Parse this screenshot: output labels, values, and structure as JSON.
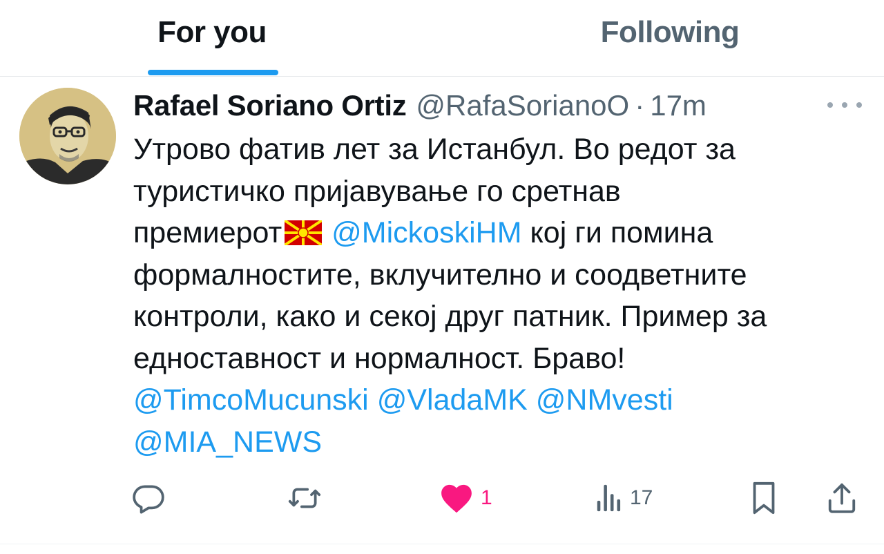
{
  "tabs": [
    {
      "label": "For you",
      "active": true
    },
    {
      "label": "Following",
      "active": false
    }
  ],
  "tweet": {
    "author": {
      "display_name": "Rafael Soriano Ortiz",
      "handle": "@RafaSorianoO",
      "separator": "·",
      "time": "17m"
    },
    "text": {
      "line1": "Утрово фатив лет за Истанбул. Во редот за",
      "line2": "туристичко пријавување го сретнав",
      "line3_prefix": "премиерот",
      "line3_flag": "north-macedonia-flag",
      "line3_mention": "@MickoskiHM",
      "line3_suffix": " кој ги помина",
      "line4": "формалностите, вклучително и соодветните",
      "line5": "контроли, како и секој друг патник. Пример за",
      "line6": "едноставност и нормалност. Браво!",
      "mentions": [
        "@TimcoMucunski",
        "@VladaMK",
        "@NMvesti",
        "@MIA_NEWS"
      ]
    },
    "actions": {
      "reply": {
        "icon": "reply-icon"
      },
      "repost": {
        "icon": "repost-icon"
      },
      "like": {
        "icon": "heart-icon",
        "count": "1",
        "liked": true
      },
      "views": {
        "icon": "views-icon",
        "count": "17"
      },
      "bookmark": {
        "icon": "bookmark-icon"
      },
      "share": {
        "icon": "share-icon"
      }
    }
  },
  "colors": {
    "accent": "#1d9bf0",
    "like": "#f91880",
    "muted": "#536471",
    "text": "#0f1419"
  }
}
